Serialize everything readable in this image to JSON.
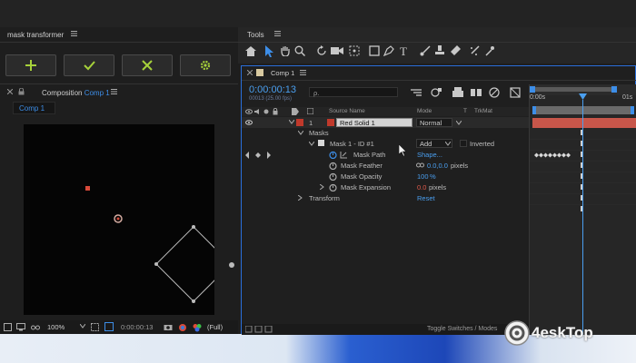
{
  "plugin_panel": {
    "title": "mask transformer",
    "menu_icon": "hamburger-icon",
    "buttons": [
      {
        "icon": "plus-icon",
        "color": "#9acd32"
      },
      {
        "icon": "check-icon",
        "color": "#9acd32"
      },
      {
        "icon": "x-icon",
        "color": "#9acd32"
      },
      {
        "icon": "gear-icon",
        "color": "#9acd32"
      }
    ]
  },
  "composition_panel": {
    "label": "Composition",
    "comp_name": "Comp 1",
    "tab": "Comp 1",
    "zoom": "100%",
    "timecode": "0:00:00:13",
    "quality": "(Full)"
  },
  "tools": {
    "title": "Tools"
  },
  "timeline": {
    "tab": "Comp 1",
    "timecode": "0:00:00:13",
    "fps": "00013 (25.00 fps)",
    "search_placeholder": "ρ.",
    "columns": {
      "source_name": "Source Name",
      "mode": "Mode",
      "t": "T",
      "trkmat": "TrkMat"
    },
    "layer": {
      "number": "1",
      "name": "Red Solid 1",
      "mode": "Normal",
      "color": "#c0392b"
    },
    "masks_group": "Masks",
    "mask": {
      "name": "Mask 1 - ID #1",
      "mode": "Add",
      "inverted": "Inverted"
    },
    "properties": [
      {
        "label": "Mask Path",
        "value": "Shape...",
        "unit": ""
      },
      {
        "label": "Mask Feather",
        "value": "0.0,0.0",
        "unit": "pixels"
      },
      {
        "label": "Mask Opacity",
        "value": "100",
        "unit": "%"
      },
      {
        "label": "Mask Expansion",
        "value": "0.0",
        "unit": "pixels"
      }
    ],
    "transform": "Transform",
    "transform_value": "Reset",
    "ruler": {
      "start": "0:00s",
      "end": "01s"
    },
    "footer": "Toggle Switches / Modes"
  },
  "watermark": {
    "text": "4eskTop"
  },
  "colors": {
    "accent": "#3d8ee8",
    "playhead": "#4a9ff0",
    "layer_bar": "#c8564a"
  }
}
